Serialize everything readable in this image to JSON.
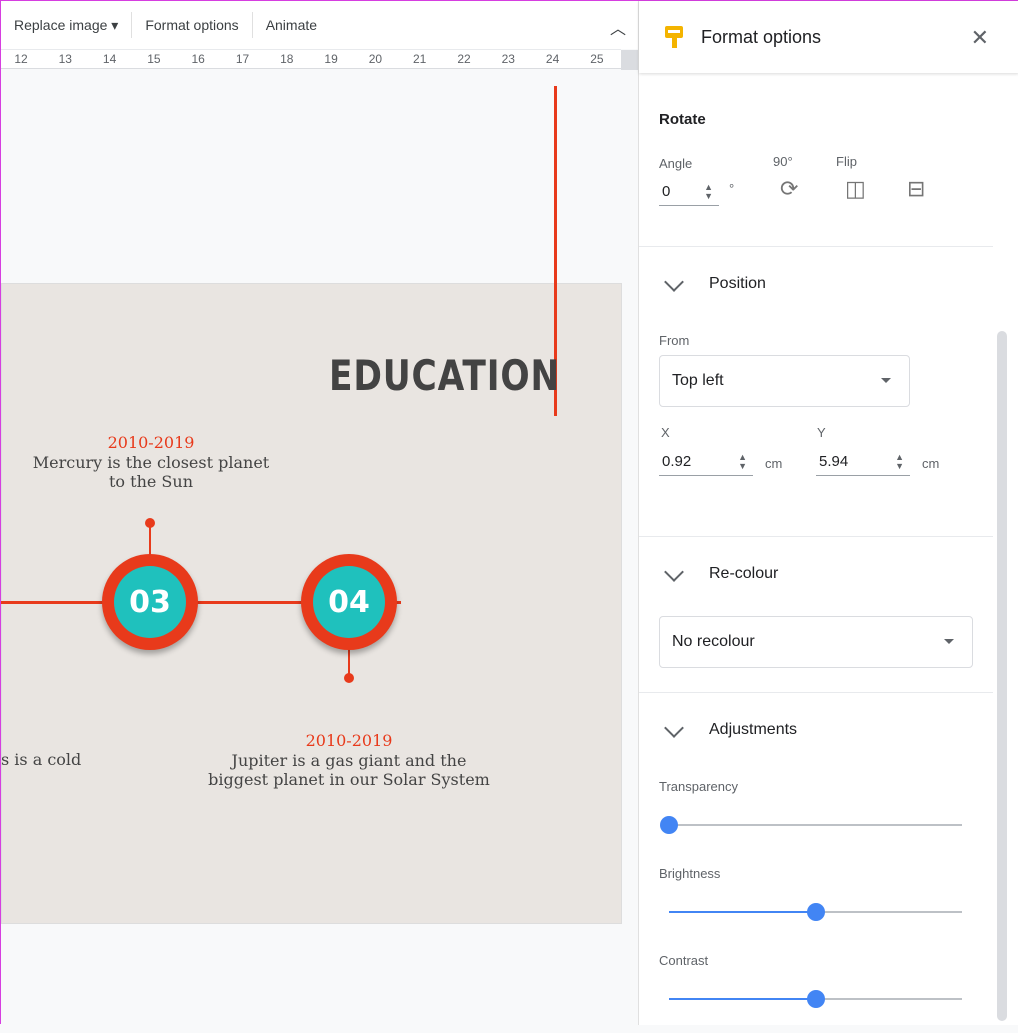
{
  "toolbar": {
    "replace_image": "Replace image ▾",
    "format_options": "Format options",
    "animate": "Animate"
  },
  "ruler": [
    "12",
    "13",
    "14",
    "15",
    "16",
    "17",
    "18",
    "19",
    "20",
    "21",
    "22",
    "23",
    "24",
    "25"
  ],
  "slide": {
    "title": "EDUCATION",
    "items": [
      {
        "number": "03",
        "date": "2010-2019",
        "desc": "Mercury is the closest planet to the Sun"
      },
      {
        "number": "04",
        "date": "2010-2019",
        "desc": "Jupiter is a gas giant and the biggest planet in our Solar System"
      }
    ],
    "partial_desc": "s is a cold"
  },
  "panel": {
    "title": "Format options",
    "rotate": {
      "heading": "Rotate",
      "angle_label": "Angle",
      "angle_value": "0",
      "degree": "°",
      "rotate_label": "90°",
      "flip_label": "Flip"
    },
    "position": {
      "heading": "Position",
      "from_label": "From",
      "from_value": "Top left",
      "x_label": "X",
      "x_value": "0.92",
      "y_label": "Y",
      "y_value": "5.94",
      "unit": "cm"
    },
    "recolour": {
      "heading": "Re-colour",
      "value": "No recolour"
    },
    "adjustments": {
      "heading": "Adjustments",
      "transparency_label": "Transparency",
      "transparency": 0,
      "brightness_label": "Brightness",
      "brightness": 50,
      "contrast_label": "Contrast",
      "contrast": 50
    }
  },
  "colors": {
    "accent": "#e83a1b",
    "teal": "#1fc1bd",
    "slider": "#4285f4",
    "logo": "#f4b400"
  }
}
